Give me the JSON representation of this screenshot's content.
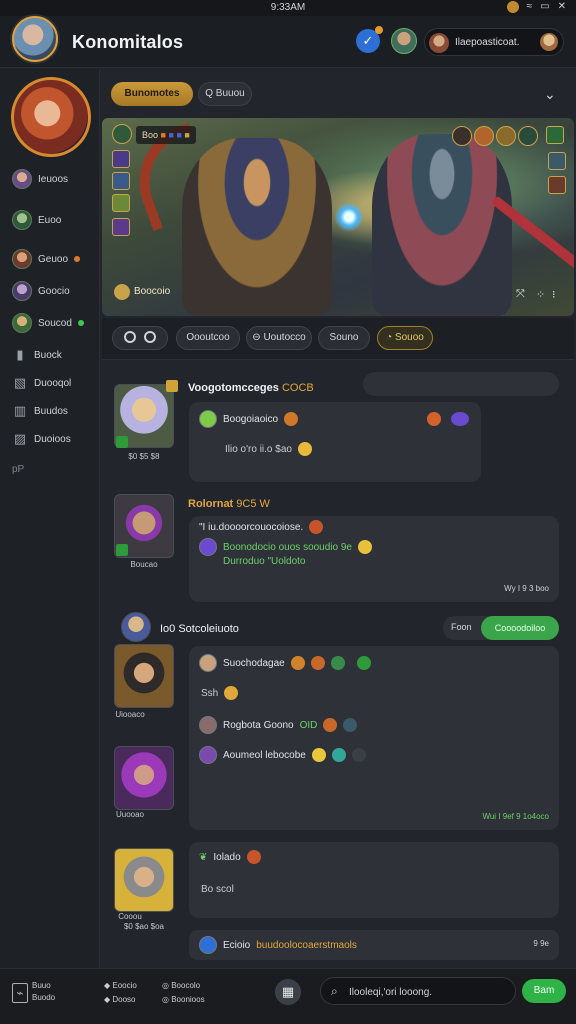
{
  "status_bar": {
    "time": "9:33AM"
  },
  "header": {
    "title": "Konomitalos",
    "user_pill_text": "Ilaepoasticoat."
  },
  "sidebar": {
    "items": [
      {
        "label": "Ieuoos"
      },
      {
        "label": "Euoo"
      },
      {
        "label": "Geuoo"
      },
      {
        "label": "Goocio"
      },
      {
        "label": "Soucod"
      },
      {
        "label": "Buock"
      },
      {
        "label": "Duooqol"
      },
      {
        "label": "Buudos"
      },
      {
        "label": "Duoioos"
      }
    ],
    "footer_glyph": "pP"
  },
  "top_pills": {
    "primary": "Bunomotes",
    "secondary": "Q Buuou"
  },
  "banner": {
    "title_chip": "Boo",
    "caption": "Boocoio"
  },
  "filters": [
    "Oooutcoo",
    "Uoutocco",
    "Souno",
    "Souoo"
  ],
  "posts": [
    {
      "author": "Voogotomcceges",
      "author_highlight": "COCB",
      "meta": "$0 $5 $8",
      "rows": [
        "Boogoiaoico",
        "Ilio o'ro ii.o $ao"
      ],
      "time": ""
    },
    {
      "author": "Rolornat",
      "author_highlight": "9C5 W",
      "meta": "Boucao",
      "rows": [
        "\"I iu.doooorcouocoiose.",
        "Boonodocio ouos sooudio 9e",
        "Durroduo \"Uoldoto"
      ],
      "time": "Wy I 9 3 boo"
    },
    {
      "group": "Io0 Sotcoleiuoto",
      "tab_left": "Foon",
      "tab_right": "Coooodoiloo",
      "author_meta_1": "Uiooaco",
      "author_meta_2": "Uuooao",
      "rows": [
        "Suochodagae",
        "Ssh",
        "Rogbota Goono",
        "Aoumeol lebocobe"
      ],
      "row3_suffix": "OID",
      "time": "Wui I 9ef 9 1o4oco"
    },
    {
      "author_meta": "Cooou",
      "author_meta_sub": "$0 $ao $oa",
      "title": "Iolado",
      "body": "Bo scol"
    }
  ],
  "composer_hint": {
    "label": "Ecioio",
    "highlight": "buudoolocoaerstmaols",
    "time": "9 9e"
  },
  "bottom_bar": {
    "left_top": "Buuo",
    "left_bottom": "Buodo",
    "col1": [
      "Eoocio",
      "Dooso"
    ],
    "col2": [
      "Boocolo",
      "Boonioos"
    ],
    "search_placeholder": "Ilooleqi,'ori looong.",
    "send_label": "Bam"
  },
  "colors": {
    "accent_gold": "#c99a3a",
    "accent_green": "#2fb347",
    "background": "#22262c",
    "card": "#2e3238"
  }
}
